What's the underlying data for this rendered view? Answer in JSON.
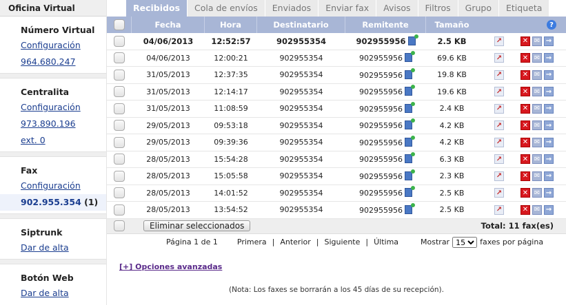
{
  "sidebar": {
    "title": "Oficina Virtual",
    "sections": [
      {
        "head": "Número Virtual",
        "links": [
          "Configuración",
          "964.680.247"
        ]
      },
      {
        "head": "Centralita",
        "links": [
          "Configuración",
          "973.890.196",
          "ext. 0"
        ]
      },
      {
        "head": "Fax",
        "links": [
          "Configuración"
        ],
        "active": "902.955.354",
        "active_count": "(1)"
      },
      {
        "head": "Siptrunk",
        "links": [
          "Dar de alta"
        ]
      },
      {
        "head": "Botón Web",
        "links": [
          "Dar de alta"
        ]
      }
    ]
  },
  "tabs": [
    "Recibidos",
    "Cola de envíos",
    "Enviados",
    "Enviar fax",
    "Avisos",
    "Filtros",
    "Grupo",
    "Etiqueta"
  ],
  "table": {
    "columns": [
      "Fecha",
      "Hora",
      "Destinatario",
      "Remitente",
      "Tamaño"
    ],
    "rows": [
      [
        "04/06/2013",
        "12:52:57",
        "902955354",
        "902955956",
        "2.5 KB"
      ],
      [
        "04/06/2013",
        "12:00:21",
        "902955354",
        "902955956",
        "69.6 KB"
      ],
      [
        "31/05/2013",
        "12:37:35",
        "902955354",
        "902955956",
        "19.8 KB"
      ],
      [
        "31/05/2013",
        "12:14:17",
        "902955354",
        "902955956",
        "19.6 KB"
      ],
      [
        "31/05/2013",
        "11:08:59",
        "902955354",
        "902955956",
        "2.4 KB"
      ],
      [
        "29/05/2013",
        "09:53:18",
        "902955354",
        "902955956",
        "4.2 KB"
      ],
      [
        "29/05/2013",
        "09:39:36",
        "902955354",
        "902955956",
        "4.2 KB"
      ],
      [
        "28/05/2013",
        "15:54:28",
        "902955354",
        "902955956",
        "6.3 KB"
      ],
      [
        "28/05/2013",
        "15:05:58",
        "902955354",
        "902955956",
        "2.3 KB"
      ],
      [
        "28/05/2013",
        "14:01:52",
        "902955354",
        "902955956",
        "2.5 KB"
      ],
      [
        "28/05/2013",
        "13:54:52",
        "902955354",
        "902955956",
        "2.5 KB"
      ]
    ],
    "unread_rows": [
      0
    ]
  },
  "footer": {
    "delete_label": "Eliminar seleccionados",
    "total": "Total: 11 fax(es)"
  },
  "pager": {
    "info": "Página 1 de 1",
    "first": "Primera",
    "prev": "Anterior",
    "next": "Siguiente",
    "last": "Última",
    "show_label": "Mostrar",
    "per_page_value": "15",
    "per_page_suffix": "faxes por página"
  },
  "advanced_link": "[+] Opciones avanzadas",
  "note": "(Nota: Los faxes se borrarán a los 45 días de su recepción)."
}
